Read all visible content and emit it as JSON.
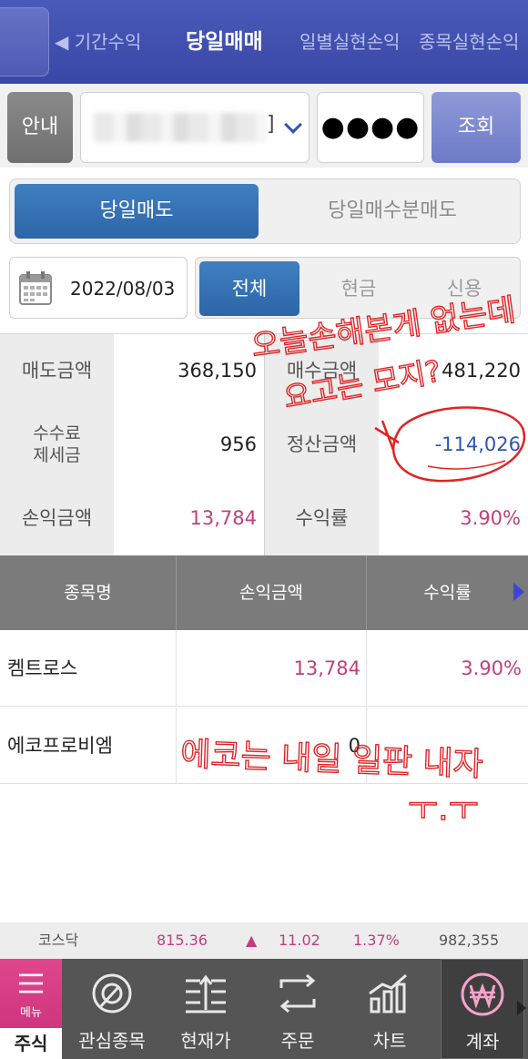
{
  "header": {
    "tabs": [
      {
        "label": "◀ 기간수익",
        "active": false
      },
      {
        "label": "당일매매",
        "active": true
      },
      {
        "label": "일별실현손익",
        "active": false
      },
      {
        "label": "종목실현손익",
        "active": false
      }
    ]
  },
  "account": {
    "guide_label": "안내",
    "account_suffix": "]",
    "password_mask": "●●●●",
    "query_label": "조회"
  },
  "sell_type": {
    "active_label": "당일매도",
    "inactive_label": "당일매수분매도"
  },
  "filter": {
    "date": "2022/08/03",
    "options": [
      "전체",
      "현금",
      "신용"
    ]
  },
  "summary": {
    "sell_amount_label": "매도금액",
    "sell_amount": "368,150",
    "buy_amount_label": "매수금액",
    "buy_amount": "481,220",
    "fee_tax_label_1": "수수료",
    "fee_tax_label_2": "제세금",
    "fee_tax": "956",
    "settlement_label": "정산금액",
    "settlement": "-114,026",
    "pl_label": "손익금액",
    "pl": "13,784",
    "return_label": "수익률",
    "return_rate": "3.90%"
  },
  "table": {
    "headers": [
      "종목명",
      "손익금액",
      "수익률"
    ],
    "rows": [
      {
        "name": "켐트로스",
        "pl": "13,784",
        "rate": "3.90%"
      },
      {
        "name": "에코프로비엠",
        "pl": "0",
        "rate": ""
      }
    ]
  },
  "ticker": {
    "index_name": "코스닥",
    "value": "815.36",
    "arrow": "▲",
    "change": "11.02",
    "percent": "1.37%",
    "volume": "982,355"
  },
  "bottom_nav": {
    "menu_label": "주식",
    "menu_sub": "메뉴",
    "items": [
      "관심종목",
      "현재가",
      "주문",
      "차트",
      "계좌"
    ]
  },
  "annotations": {
    "note_1": "오늘손해본게 없는데",
    "note_2": "요고는 모지?",
    "note_3": "에코는 내일 일판 내자",
    "note_4": "ㅜ.ㅜ"
  },
  "colors": {
    "header_bg": "#3947a6",
    "active_blue": "#2c66a8",
    "profit_pink": "#c0407a",
    "loss_blue": "#2e55b3",
    "menu_pink": "#c42f78",
    "annotation_red": "#e02424"
  }
}
